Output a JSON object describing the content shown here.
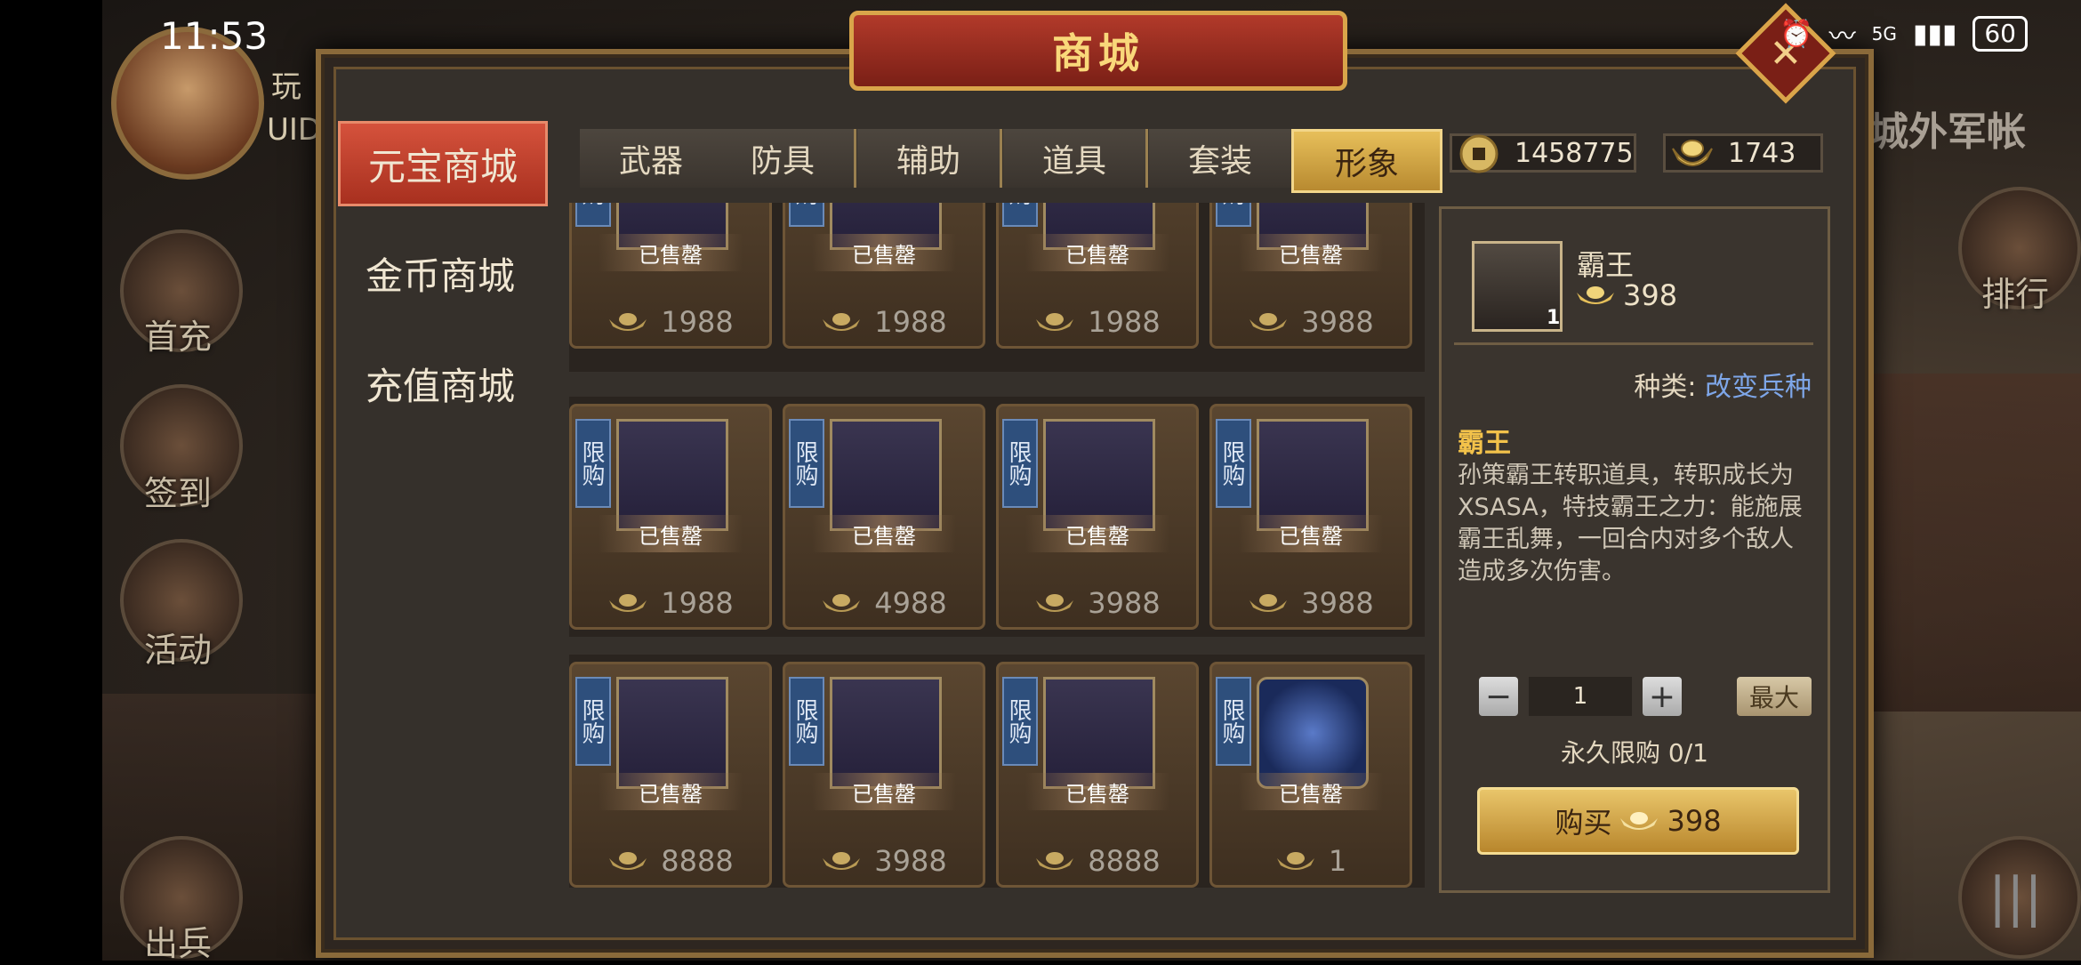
{
  "status_bar": {
    "time": "11:53",
    "network": "5G",
    "battery": "60"
  },
  "hud": {
    "player_name": "玩",
    "player_uid": "UID",
    "side_buttons": [
      "首充",
      "签到",
      "活动",
      "出兵"
    ],
    "right_labels": [
      "城外军帐",
      "排行"
    ]
  },
  "shop": {
    "title": "商城",
    "nav": [
      "元宝商城",
      "金币商城",
      "充值商城"
    ],
    "tabs": [
      "武器",
      "防具",
      "辅助",
      "道具",
      "套装",
      "形象"
    ],
    "gold": "1458775",
    "yuanbao": "1743",
    "sold_label": "已售罄",
    "limit_tag": "限购",
    "rows": [
      {
        "prices": [
          "1988",
          "1988",
          "1988",
          "3988"
        ]
      },
      {
        "prices": [
          "1988",
          "4988",
          "3988",
          "3988"
        ]
      },
      {
        "prices": [
          "8888",
          "3988",
          "8888",
          "1"
        ]
      }
    ]
  },
  "detail": {
    "name": "霸王",
    "count": "1",
    "price": "398",
    "category_label": "种类:",
    "category_value": "改变兵种",
    "desc_title": "霸王",
    "description": "孙策霸王转职道具，转职成长为XSASA，特技霸王之力：能施展霸王乱舞，一回合内对多个敌人造成多次伤害。",
    "quantity": "1",
    "max_label": "最大",
    "limit_text": "永久限购 0/1",
    "buy_label": "购买",
    "buy_price": "398"
  },
  "colors": {
    "accent_red": "#b23a2a",
    "gold": "#e7bf5a",
    "link_blue": "#7ea6e8"
  }
}
